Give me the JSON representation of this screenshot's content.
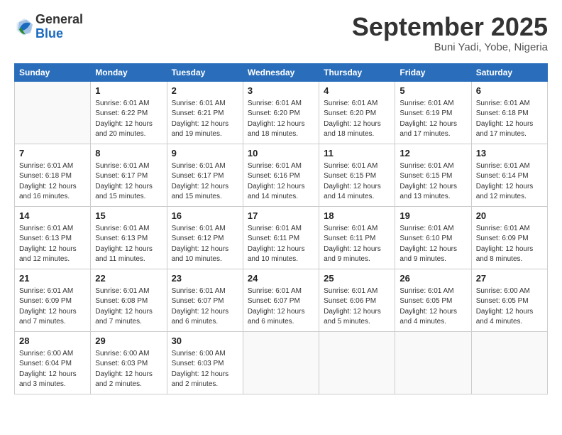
{
  "header": {
    "logo_general": "General",
    "logo_blue": "Blue",
    "month": "September 2025",
    "location": "Buni Yadi, Yobe, Nigeria"
  },
  "weekdays": [
    "Sunday",
    "Monday",
    "Tuesday",
    "Wednesday",
    "Thursday",
    "Friday",
    "Saturday"
  ],
  "weeks": [
    [
      {
        "day": "",
        "info": ""
      },
      {
        "day": "1",
        "info": "Sunrise: 6:01 AM\nSunset: 6:22 PM\nDaylight: 12 hours\nand 20 minutes."
      },
      {
        "day": "2",
        "info": "Sunrise: 6:01 AM\nSunset: 6:21 PM\nDaylight: 12 hours\nand 19 minutes."
      },
      {
        "day": "3",
        "info": "Sunrise: 6:01 AM\nSunset: 6:20 PM\nDaylight: 12 hours\nand 18 minutes."
      },
      {
        "day": "4",
        "info": "Sunrise: 6:01 AM\nSunset: 6:20 PM\nDaylight: 12 hours\nand 18 minutes."
      },
      {
        "day": "5",
        "info": "Sunrise: 6:01 AM\nSunset: 6:19 PM\nDaylight: 12 hours\nand 17 minutes."
      },
      {
        "day": "6",
        "info": "Sunrise: 6:01 AM\nSunset: 6:18 PM\nDaylight: 12 hours\nand 17 minutes."
      }
    ],
    [
      {
        "day": "7",
        "info": "Sunrise: 6:01 AM\nSunset: 6:18 PM\nDaylight: 12 hours\nand 16 minutes."
      },
      {
        "day": "8",
        "info": "Sunrise: 6:01 AM\nSunset: 6:17 PM\nDaylight: 12 hours\nand 15 minutes."
      },
      {
        "day": "9",
        "info": "Sunrise: 6:01 AM\nSunset: 6:17 PM\nDaylight: 12 hours\nand 15 minutes."
      },
      {
        "day": "10",
        "info": "Sunrise: 6:01 AM\nSunset: 6:16 PM\nDaylight: 12 hours\nand 14 minutes."
      },
      {
        "day": "11",
        "info": "Sunrise: 6:01 AM\nSunset: 6:15 PM\nDaylight: 12 hours\nand 14 minutes."
      },
      {
        "day": "12",
        "info": "Sunrise: 6:01 AM\nSunset: 6:15 PM\nDaylight: 12 hours\nand 13 minutes."
      },
      {
        "day": "13",
        "info": "Sunrise: 6:01 AM\nSunset: 6:14 PM\nDaylight: 12 hours\nand 12 minutes."
      }
    ],
    [
      {
        "day": "14",
        "info": "Sunrise: 6:01 AM\nSunset: 6:13 PM\nDaylight: 12 hours\nand 12 minutes."
      },
      {
        "day": "15",
        "info": "Sunrise: 6:01 AM\nSunset: 6:13 PM\nDaylight: 12 hours\nand 11 minutes."
      },
      {
        "day": "16",
        "info": "Sunrise: 6:01 AM\nSunset: 6:12 PM\nDaylight: 12 hours\nand 10 minutes."
      },
      {
        "day": "17",
        "info": "Sunrise: 6:01 AM\nSunset: 6:11 PM\nDaylight: 12 hours\nand 10 minutes."
      },
      {
        "day": "18",
        "info": "Sunrise: 6:01 AM\nSunset: 6:11 PM\nDaylight: 12 hours\nand 9 minutes."
      },
      {
        "day": "19",
        "info": "Sunrise: 6:01 AM\nSunset: 6:10 PM\nDaylight: 12 hours\nand 9 minutes."
      },
      {
        "day": "20",
        "info": "Sunrise: 6:01 AM\nSunset: 6:09 PM\nDaylight: 12 hours\nand 8 minutes."
      }
    ],
    [
      {
        "day": "21",
        "info": "Sunrise: 6:01 AM\nSunset: 6:09 PM\nDaylight: 12 hours\nand 7 minutes."
      },
      {
        "day": "22",
        "info": "Sunrise: 6:01 AM\nSunset: 6:08 PM\nDaylight: 12 hours\nand 7 minutes."
      },
      {
        "day": "23",
        "info": "Sunrise: 6:01 AM\nSunset: 6:07 PM\nDaylight: 12 hours\nand 6 minutes."
      },
      {
        "day": "24",
        "info": "Sunrise: 6:01 AM\nSunset: 6:07 PM\nDaylight: 12 hours\nand 6 minutes."
      },
      {
        "day": "25",
        "info": "Sunrise: 6:01 AM\nSunset: 6:06 PM\nDaylight: 12 hours\nand 5 minutes."
      },
      {
        "day": "26",
        "info": "Sunrise: 6:01 AM\nSunset: 6:05 PM\nDaylight: 12 hours\nand 4 minutes."
      },
      {
        "day": "27",
        "info": "Sunrise: 6:00 AM\nSunset: 6:05 PM\nDaylight: 12 hours\nand 4 minutes."
      }
    ],
    [
      {
        "day": "28",
        "info": "Sunrise: 6:00 AM\nSunset: 6:04 PM\nDaylight: 12 hours\nand 3 minutes."
      },
      {
        "day": "29",
        "info": "Sunrise: 6:00 AM\nSunset: 6:03 PM\nDaylight: 12 hours\nand 2 minutes."
      },
      {
        "day": "30",
        "info": "Sunrise: 6:00 AM\nSunset: 6:03 PM\nDaylight: 12 hours\nand 2 minutes."
      },
      {
        "day": "",
        "info": ""
      },
      {
        "day": "",
        "info": ""
      },
      {
        "day": "",
        "info": ""
      },
      {
        "day": "",
        "info": ""
      }
    ]
  ]
}
